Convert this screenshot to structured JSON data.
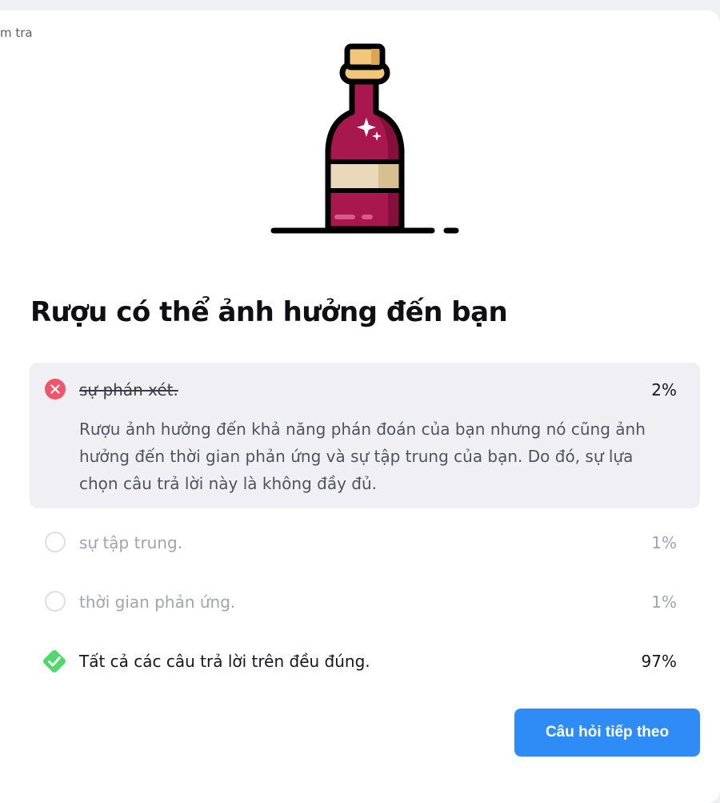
{
  "breadcrumb": {
    "text": "m tra"
  },
  "illustration": {
    "icon": "wine-bottle-icon"
  },
  "question": {
    "title": "Rượu có thể ảnh hưởng đến bạn"
  },
  "options": [
    {
      "label": "sự phán xét.",
      "percent": "2%",
      "state": "wrong",
      "icon": "x-circle-icon",
      "explanation": "Rượu ảnh hưởng đến khả năng phán đoán của bạn nhưng nó cũng ảnh hưởng đến thời gian phản ứng và sự tập trung của bạn. Do đó, sự lựa chọn câu trả lời này là không đầy đủ."
    },
    {
      "label": "sự tập trung.",
      "percent": "1%",
      "state": "unselected",
      "icon": "radio-empty-icon"
    },
    {
      "label": "thời gian phản ứng.",
      "percent": "1%",
      "state": "unselected",
      "icon": "radio-empty-icon"
    },
    {
      "label": "Tất cả các câu trả lời trên đều đúng.",
      "percent": "97%",
      "state": "correct",
      "icon": "check-diamond-icon"
    }
  ],
  "colors": {
    "wrong": "#f0566a",
    "correct": "#4fd96a",
    "button": "#2f8cf6",
    "highlight": "#f0f0f4"
  },
  "next_button": {
    "label": "Câu hỏi tiếp theo"
  }
}
